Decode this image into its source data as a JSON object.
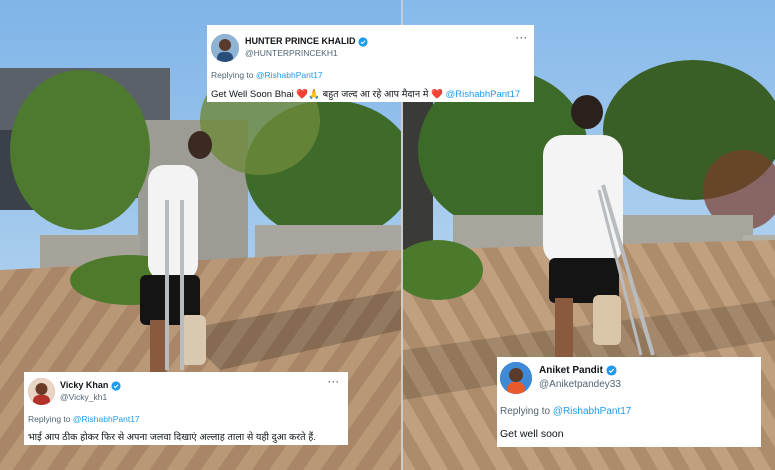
{
  "tweets": [
    {
      "name": "HUNTER PRINCE KHALID",
      "handle": "@HUNTERPRINCEKH1",
      "replying_prefix": "Replying to",
      "replying_to": "@RishabhPant17",
      "text_part1": "Get Well Soon Bhai",
      "emoji1": "❤️🙏",
      "text_part2": "बहुत जल्द आ रहे आप मैदान मे",
      "emoji2": "❤️",
      "mention": "@RishabhPant17",
      "more": "···"
    },
    {
      "name": "Vicky Khan",
      "handle": "@Vicky_kh1",
      "replying_prefix": "Replying to",
      "replying_to": "@RishabhPant17",
      "text": "भाई आप ठीक होकर फिर से अपना जलवा दिखाएं अल्लाह ताला से यही दुआ करते हैं.",
      "more": "···"
    },
    {
      "name": "Aniket Pandit",
      "handle": "@Aniketpandey33",
      "replying_prefix": "Replying to",
      "replying_to": "@RishabhPant17",
      "text": "Get well soon"
    }
  ],
  "colors": {
    "link": "#1d9bf0",
    "verified": "#1d9bf0",
    "muted": "#536471",
    "heart": "#e0245e"
  },
  "icons": [
    "verified-badge-icon",
    "more-options-icon"
  ]
}
